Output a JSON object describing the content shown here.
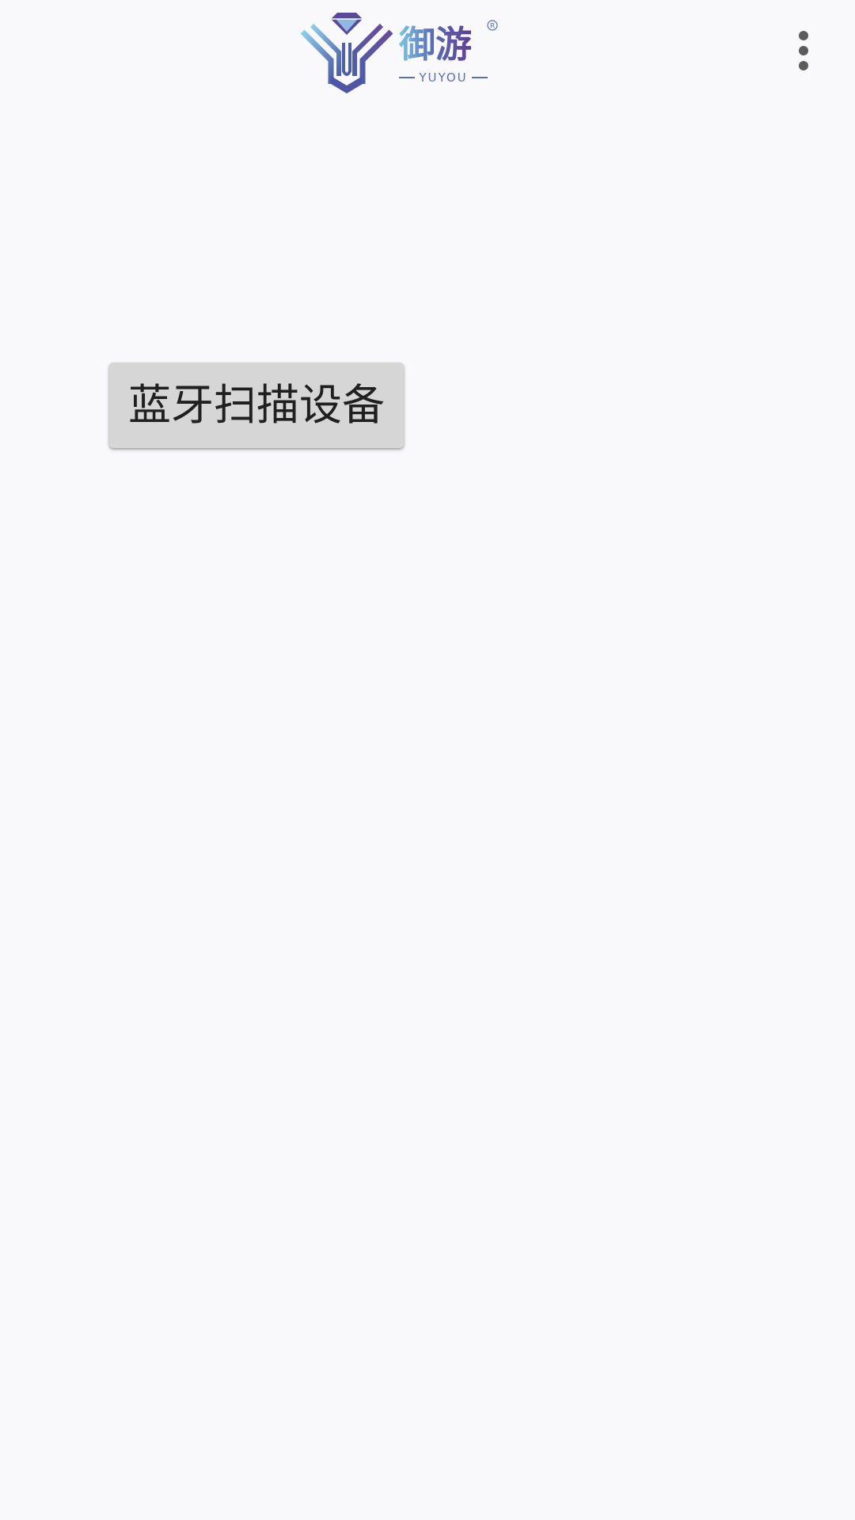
{
  "app_bar": {
    "logo": {
      "brand_cn": "御游",
      "brand_en": "YUYOU",
      "registered_mark": "R",
      "colors": {
        "light": "#7dc3e0",
        "mid": "#5a78b8",
        "dark": "#5a3d8f"
      }
    },
    "overflow_icon": "more-vertical-icon"
  },
  "main": {
    "scan_button_label": "蓝牙扫描设备"
  }
}
